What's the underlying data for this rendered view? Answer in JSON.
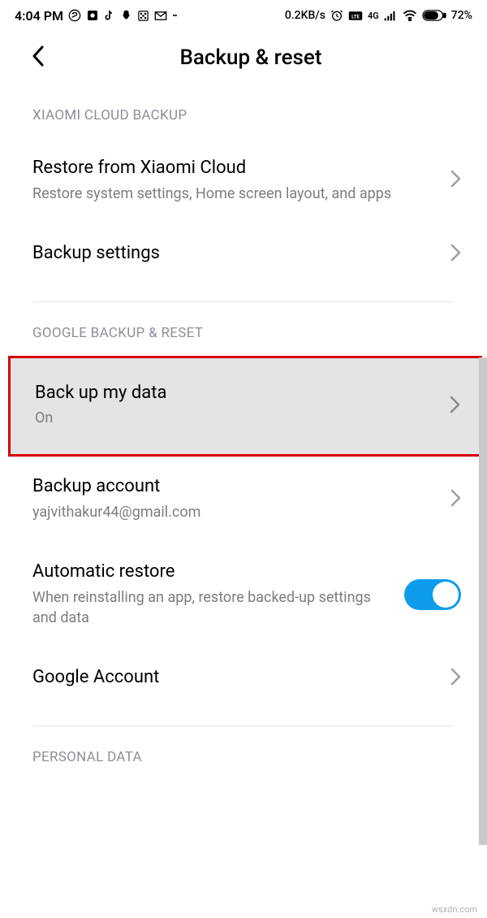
{
  "status": {
    "time": "4:04 PM",
    "speed": "0.2KB/s",
    "battery": "72%",
    "signal": "4G"
  },
  "header": {
    "title": "Backup & reset"
  },
  "sections": {
    "xiaomi": {
      "label": "XIAOMI CLOUD BACKUP",
      "restore": {
        "title": "Restore from Xiaomi Cloud",
        "sub": "Restore system settings, Home screen layout, and apps"
      },
      "backup_settings": {
        "title": "Backup settings"
      }
    },
    "google": {
      "label": "GOOGLE BACKUP & RESET",
      "backup_data": {
        "title": "Back up my data",
        "sub": "On"
      },
      "account": {
        "title": "Backup account",
        "sub": "yajvithakur44@gmail.com"
      },
      "auto_restore": {
        "title": "Automatic restore",
        "sub": "When reinstalling an app, restore backed-up settings and data"
      },
      "google_account": {
        "title": "Google Account"
      }
    },
    "personal": {
      "label": "PERSONAL DATA"
    }
  },
  "watermark": "wsxdn.com"
}
